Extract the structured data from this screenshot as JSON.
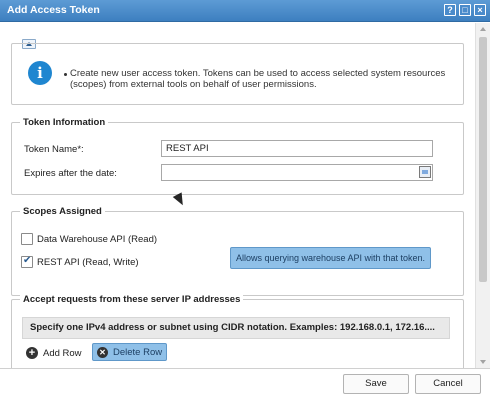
{
  "window": {
    "title": "Add Access Token",
    "controls": {
      "help": "?",
      "restore": "□",
      "close": "×"
    }
  },
  "info": {
    "text": "Create new user access token. Tokens can be used to access selected system resources (scopes) from external tools on behalf of user permissions."
  },
  "token_information": {
    "legend": "Token Information",
    "name_label": "Token Name*:",
    "name_value": "REST API",
    "expires_label": "Expires after the date:",
    "expires_value": ""
  },
  "scopes": {
    "legend": "Scopes Assigned",
    "items": [
      {
        "label": "Data Warehouse API (Read)",
        "checked": false
      },
      {
        "label": "REST API (Read, Write)",
        "checked": true
      }
    ],
    "tooltip": "Allows querying warehouse API with that token."
  },
  "ip_section": {
    "legend": "Accept requests from these server IP addresses",
    "header": "Specify one IPv4 address or subnet using CIDR notation. Examples: 192.168.0.1, 172.16....",
    "add_row": "Add Row",
    "delete_row": "Delete Row"
  },
  "footer": {
    "save": "Save",
    "cancel": "Cancel"
  }
}
